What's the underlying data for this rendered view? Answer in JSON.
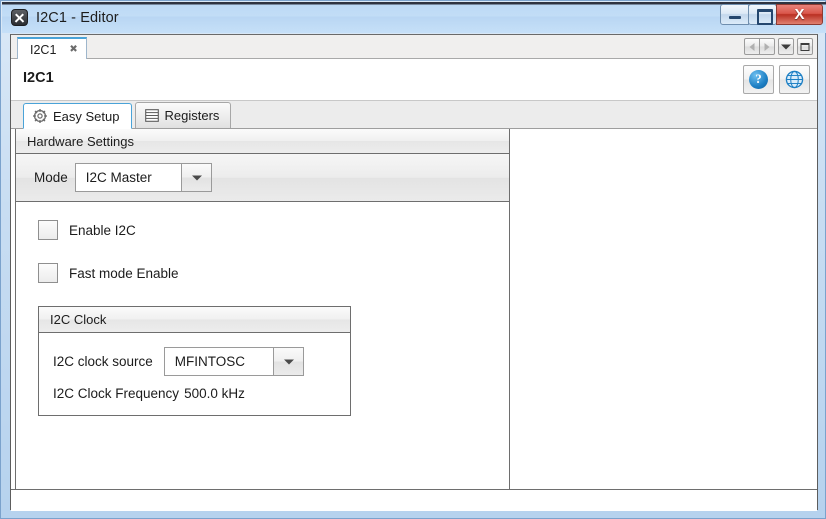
{
  "window": {
    "title": "I2C1 - Editor",
    "icon": "app-x-icon",
    "controls": {
      "minimize": "–",
      "maximize": "□",
      "close": "X"
    }
  },
  "tab_strip": {
    "document_tab": {
      "label": "I2C1",
      "close": "✖"
    },
    "nav": {
      "scroll_left": "left-arrow-icon",
      "scroll_right": "right-arrow-icon",
      "tab_list": "chevron-down-icon",
      "restore": "restore-icon"
    }
  },
  "header": {
    "title": "I2C1",
    "help_button": "?",
    "globe_button": "globe-icon"
  },
  "inner_tabs": [
    {
      "label": "Easy Setup",
      "icon": "gear-icon",
      "active": true
    },
    {
      "label": "Registers",
      "icon": "register-list-icon",
      "active": false
    }
  ],
  "hardware_settings": {
    "group_title": "Hardware Settings",
    "mode": {
      "label": "Mode",
      "value": "I2C Master"
    },
    "checkboxes": [
      {
        "label": "Enable I2C",
        "checked": false
      },
      {
        "label": "Fast mode Enable",
        "checked": false
      }
    ],
    "i2c_clock": {
      "group_title": "I2C Clock",
      "clock_source": {
        "label": "I2C clock source",
        "value": "MFINTOSC"
      },
      "frequency": {
        "label": "I2C Clock Frequency",
        "value": "500.0 kHz"
      }
    }
  },
  "colors": {
    "title_bar": "#bcd9f5",
    "accent_tab": "#4aa3d8",
    "close_button": "#b92f22",
    "panel_border": "#6e6e6e",
    "icon_blue": "#1d7fc4"
  }
}
